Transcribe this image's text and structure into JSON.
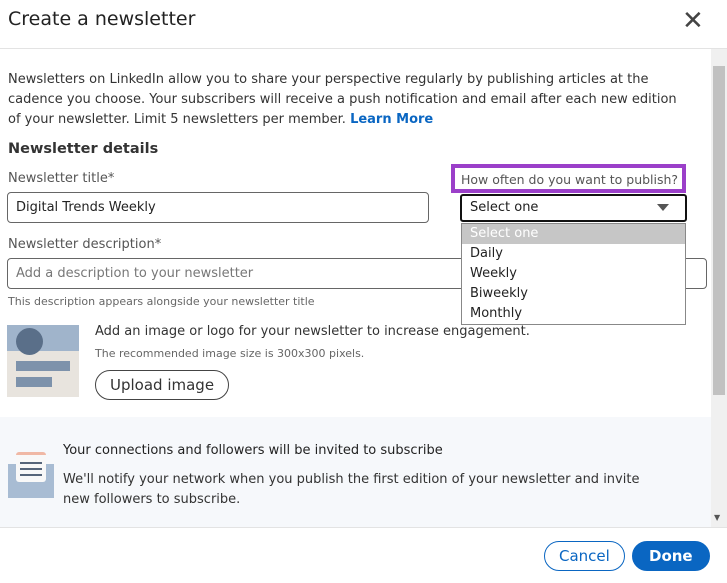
{
  "dialog": {
    "title": "Create a newsletter",
    "close_icon": "close-icon"
  },
  "intro": {
    "text": "Newsletters on LinkedIn allow you to share your perspective regularly by publishing articles at the cadence you choose. Your subscribers will receive a push notification and email after each new edition of your newsletter. Limit 5 newsletters per member. ",
    "link": "Learn More"
  },
  "details": {
    "heading": "Newsletter details",
    "title_label": "Newsletter title*",
    "title_value": "Digital Trends Weekly",
    "desc_label": "Newsletter description*",
    "desc_placeholder": "Add a description to your newsletter",
    "desc_hint": "This description appears alongside your newsletter title",
    "freq_label": "How often do you want to publish?",
    "freq_value": "Select one",
    "freq_options": [
      "Select one",
      "Daily",
      "Weekly",
      "Biweekly",
      "Monthly"
    ]
  },
  "image": {
    "text": "Add an image or logo for your newsletter to increase engagement.",
    "hint": "The recommended image size is 300x300 pixels.",
    "button": "Upload image"
  },
  "invite": {
    "title": "Your connections and followers will be invited to subscribe",
    "text": "We'll notify your network when you publish the first edition of your newsletter and invite new followers to subscribe."
  },
  "footer": {
    "cancel": "Cancel",
    "done": "Done"
  },
  "colors": {
    "accent": "#0a66c2",
    "highlight": "#9b3fc9"
  }
}
